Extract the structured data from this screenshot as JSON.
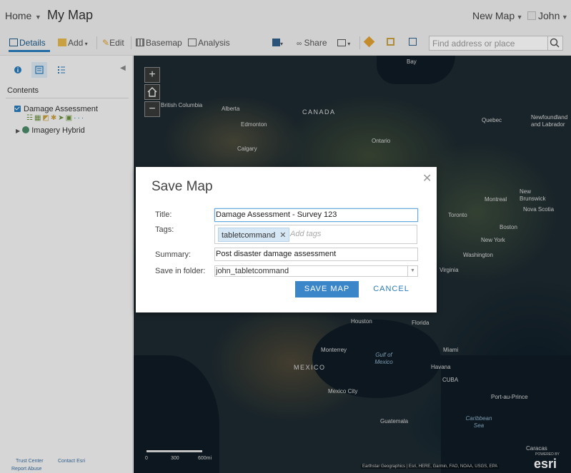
{
  "header": {
    "home_label": "Home",
    "app_title": "My Map",
    "new_map_label": "New Map",
    "user_name": "John"
  },
  "toolbar": {
    "details": "Details",
    "add": "Add",
    "edit": "Edit",
    "basemap": "Basemap",
    "analysis": "Analysis",
    "share": "Share",
    "search_placeholder": "Find address or place"
  },
  "sidebar": {
    "contents_label": "Contents",
    "layers": [
      {
        "name": "Damage Assessment",
        "checked": true
      },
      {
        "name": "Imagery Hybrid"
      }
    ],
    "footer": {
      "trust_center": "Trust Center",
      "contact": "Contact Esri",
      "report_abuse": "Report Abuse"
    }
  },
  "map": {
    "labels": [
      "Alberta",
      "CANADA",
      "Edmonton",
      "Calgary",
      "Ontario",
      "Quebec",
      "Newfoundland and Labrador",
      "Montreal",
      "New Brunswick",
      "Nova Scotia",
      "Toronto",
      "New York",
      "Boston",
      "Washington",
      "Virginia",
      "Houston",
      "Florida",
      "Monterrey",
      "Gulf of Mexico",
      "MEXICO",
      "Miami",
      "Havana",
      "CUBA",
      "Mexico City",
      "Port-au-Prince",
      "Caribbean Sea",
      "Guatemala",
      "Caracas",
      "British Columbia",
      "Bay"
    ],
    "scale": {
      "s0": "0",
      "s1": "300",
      "s2": "600mi"
    },
    "attribution": "Earthstar Geographics | Esri, HERE, Garmin, FAO, NOAA, USGS, EPA",
    "logo": "esri",
    "powered_by": "POWERED BY"
  },
  "dialog": {
    "title": "Save Map",
    "title_label": "Title:",
    "title_value": "Damage Assessment - Survey 123",
    "tags_label": "Tags:",
    "tags": [
      "tabletcommand"
    ],
    "tags_placeholder": "Add tags",
    "summary_label": "Summary:",
    "summary_value": "Post disaster damage assessment",
    "folder_label": "Save in folder:",
    "folder_value": "john_tabletcommand",
    "save_button": "SAVE MAP",
    "cancel_button": "CANCEL"
  },
  "colors": {
    "accent": "#2a7bbb",
    "save_button_bg": "#3b86c8",
    "tag_bg": "#d6e7f5"
  }
}
